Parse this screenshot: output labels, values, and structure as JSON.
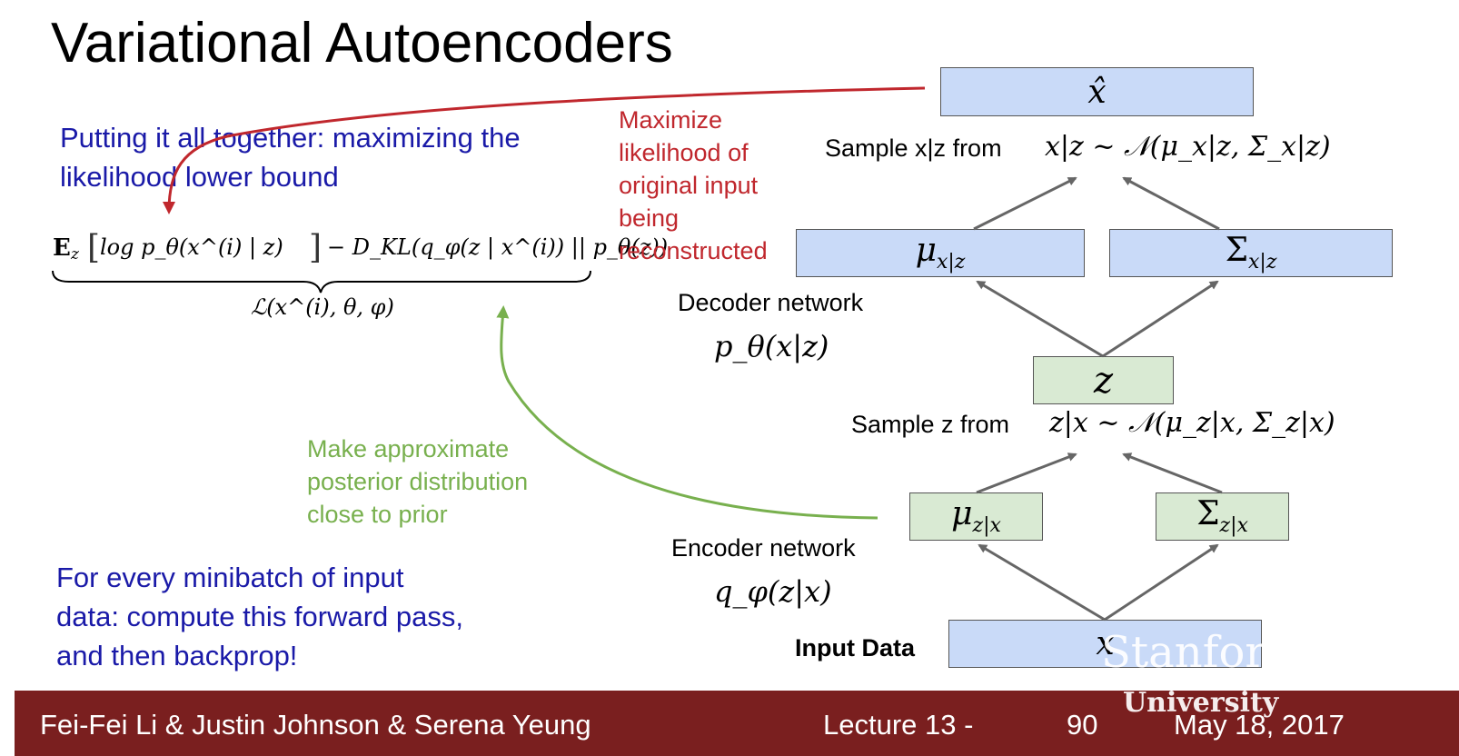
{
  "slide": {
    "title": "Variational Autoencoders",
    "intro_text": "Putting it all together: maximizing the likelihood lower bound",
    "equation": {
      "expectation": "E",
      "expectation_sub": "z",
      "log_term": "log p_θ(x^(i) | z)",
      "kl_term": "− D_KL(q_φ(z | x^(i)) || p_θ(z))",
      "elbo_label": "ℒ(x^(i), θ, φ)"
    },
    "red_annotation": "Maximize likelihood of original input being reconstructed",
    "green_annotation": "Make approximate posterior distribution close to prior",
    "bottom_text": "For every minibatch of input data: compute this forward pass, and then backprop!"
  },
  "diagram": {
    "x_hat": "x̂",
    "sample_x_label": "Sample x|z from",
    "sample_x_math": "x|z ~ 𝒩(μ_x|z, Σ_x|z)",
    "mu_x": "μ",
    "mu_x_sub": "x|z",
    "sigma_x": "Σ",
    "sigma_x_sub": "x|z",
    "decoder_label": "Decoder network",
    "decoder_math": "p_θ(x|z)",
    "z_box": "z",
    "sample_z_label": "Sample z from",
    "sample_z_math": "z|x ~ 𝒩(μ_z|x, Σ_z|x)",
    "mu_z": "μ",
    "mu_z_sub": "z|x",
    "sigma_z": "Σ",
    "sigma_z_sub": "z|x",
    "encoder_label": "Encoder network",
    "encoder_math": "q_φ(z|x)",
    "input_label": "Input Data",
    "input_box": "x"
  },
  "footer": {
    "authors": "Fei-Fei Li & Justin Johnson & Serena Yeung",
    "lecture": "Lecture 13 -",
    "page": "90",
    "date": "May 18, 2017"
  },
  "watermark": {
    "line1": "Stanford",
    "line2": "University"
  },
  "colors": {
    "blue_box": "#c9daf8",
    "green_box": "#d9ead3",
    "footer_bg": "#7a1f1f",
    "blue_text": "#1a1aa8",
    "red_text": "#c0272d",
    "green_text": "#78b04e",
    "arrow_gray": "#666666"
  }
}
